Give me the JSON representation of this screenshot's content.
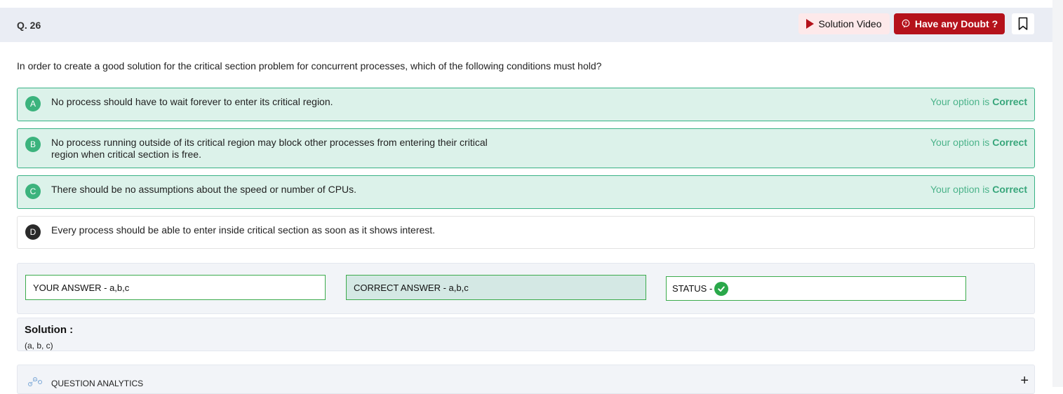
{
  "header": {
    "question_number": "Q. 26",
    "solution_video_label": "Solution Video",
    "doubt_label": "Have any Doubt ?"
  },
  "question": {
    "text": "In order to create a good solution for the critical section problem for concurrent processes, which of the following conditions must hold?"
  },
  "options": [
    {
      "letter": "A",
      "line1": "No process should have to wait forever to enter its critical region.",
      "line2": "",
      "status_prefix": "Your option is ",
      "status_value": "Correct"
    },
    {
      "letter": "B",
      "line1": "No process running outside of its critical region may block other processes from entering their critical",
      "line2": "region when critical section is free.",
      "status_prefix": "Your option is ",
      "status_value": "Correct"
    },
    {
      "letter": "C",
      "line1": "There should be no assumptions about the speed or number of CPUs.",
      "line2": "",
      "status_prefix": "Your option is ",
      "status_value": "Correct"
    },
    {
      "letter": "D",
      "line1": "Every process should be able to enter inside critical section as soon as it shows interest.",
      "line2": ""
    }
  ],
  "answers": {
    "your_answer": "YOUR ANSWER - a,b,c",
    "correct_answer": "CORRECT ANSWER - a,b,c",
    "status_label": "STATUS -"
  },
  "solution": {
    "title": "Solution :",
    "body": "(a, b, c)"
  },
  "analytics": {
    "label": "QUESTION ANALYTICS",
    "expand_glyph": "+"
  },
  "colors": {
    "accent_red": "#b5121b",
    "correct_green": "#38b285",
    "option_bg": "#dcf2ea"
  },
  "icons": [
    "play-icon",
    "doubt-icon",
    "bookmark-icon",
    "check-icon",
    "analytics-icon",
    "plus-icon"
  ]
}
